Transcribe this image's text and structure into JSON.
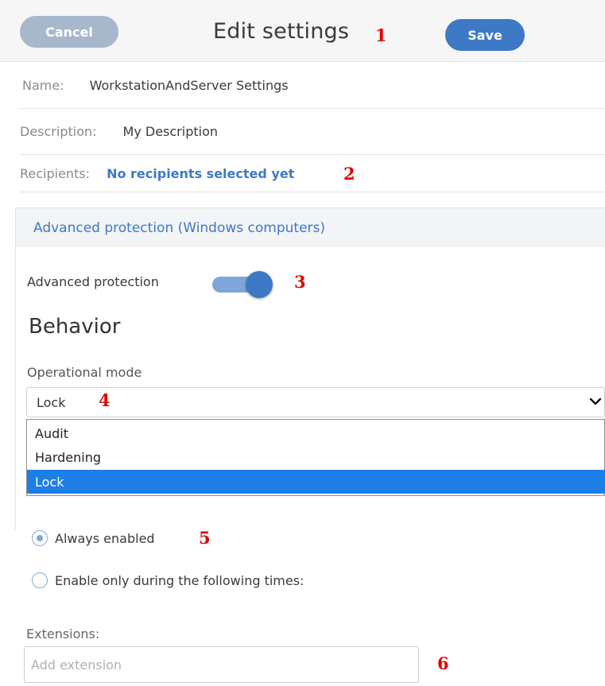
{
  "header": {
    "title": "Edit settings",
    "cancel_label": "Cancel",
    "save_label": "Save"
  },
  "fields": {
    "name_label": "Name:",
    "name_value": "WorkstationAndServer Settings",
    "description_label": "Description:",
    "description_value": "My Description",
    "recipients_label": "Recipients:",
    "recipients_value": "No recipients selected yet"
  },
  "section": {
    "title": "Advanced protection (Windows computers)",
    "toggle_label": "Advanced protection",
    "toggle_on": true,
    "behavior_heading": "Behavior",
    "operational_mode_label": "Operational mode",
    "operational_mode_value": "Lock",
    "options": [
      {
        "label": "Audit",
        "selected": false
      },
      {
        "label": "Hardening",
        "selected": false
      },
      {
        "label": "Lock",
        "selected": true
      }
    ],
    "radio_always": "Always enabled",
    "radio_times": "Enable only during the following times:",
    "extensions_label": "Extensions:",
    "extensions_placeholder": "Add extension"
  },
  "annotations": [
    "1",
    "2",
    "3",
    "4",
    "5",
    "6"
  ],
  "colors": {
    "accent": "#3d79c4",
    "cancel": "#a7b8cc",
    "annotation": "#e30000",
    "selected_option": "#1e7ee8"
  },
  "icons": {
    "select_chevron": "chevron-down-icon"
  }
}
